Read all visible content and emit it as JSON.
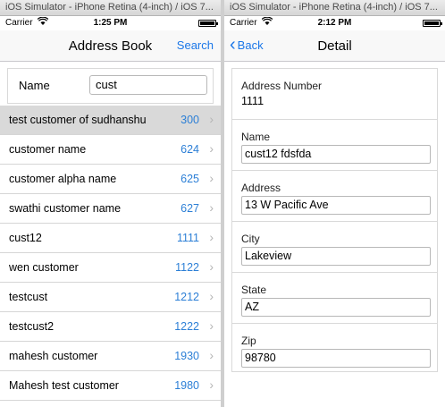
{
  "left": {
    "window_title": "iOS Simulator - iPhone Retina (4-inch) / iOS 7...",
    "status": {
      "carrier": "Carrier",
      "time": "1:25 PM"
    },
    "nav": {
      "title": "Address Book",
      "search_label": "Search"
    },
    "search": {
      "label": "Name",
      "value": "cust"
    },
    "rows": [
      {
        "name": "test customer of sudhanshu",
        "number": "300"
      },
      {
        "name": "customer name",
        "number": "624"
      },
      {
        "name": "customer alpha name",
        "number": "625"
      },
      {
        "name": "swathi customer name",
        "number": "627"
      },
      {
        "name": "cust12",
        "number": "1111"
      },
      {
        "name": "wen customer",
        "number": "1122"
      },
      {
        "name": "testcust",
        "number": "1212"
      },
      {
        "name": "testcust2",
        "number": "1222"
      },
      {
        "name": "mahesh customer",
        "number": "1930"
      },
      {
        "name": "Mahesh test customer",
        "number": "1980"
      }
    ],
    "selected_row": 0,
    "accent_color": "#1b77e8",
    "number_color": "#2c7fd6"
  },
  "right": {
    "window_title": "iOS Simulator - iPhone Retina (4-inch) / iOS 7...",
    "status": {
      "carrier": "Carrier",
      "time": "2:12 PM"
    },
    "nav": {
      "back_label": "Back",
      "title": "Detail"
    },
    "fields": {
      "address_number": {
        "label": "Address Number",
        "value": "1111"
      },
      "name": {
        "label": "Name",
        "value": "cust12 fdsfda"
      },
      "address": {
        "label": "Address",
        "value": "13 W Pacific Ave"
      },
      "city": {
        "label": "City",
        "value": "Lakeview"
      },
      "state": {
        "label": "State",
        "value": "AZ"
      },
      "zip": {
        "label": "Zip",
        "value": "98780"
      }
    }
  }
}
